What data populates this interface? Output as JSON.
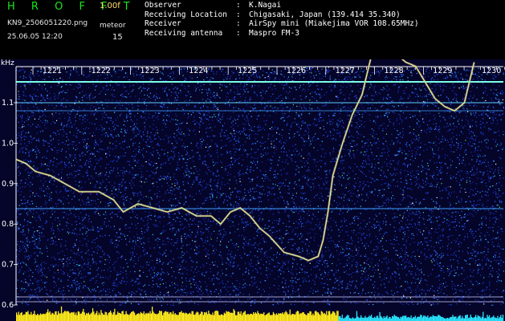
{
  "header": {
    "logo": "H R O F F T",
    "version": "1.00f",
    "filename": "KN9_2506051220.png",
    "timestamp": "25.06.05 12:20",
    "meteor_label": "meteor",
    "meteor_count": "15"
  },
  "info": [
    {
      "key": "Observer",
      "sep": ":",
      "value": "K.Nagai"
    },
    {
      "key": "Receiving Location",
      "sep": ":",
      "value": "Chigasaki, Japan (139.414 35.340)"
    },
    {
      "key": "Receiver",
      "sep": ":",
      "value": "AirSpy mini (Miakejima VOR 108.65MHz)"
    },
    {
      "key": "Receiving antenna",
      "sep": ":",
      "value": "Maspro FM-3"
    }
  ],
  "axis": {
    "y_unit": "kHz",
    "y_ticks": [
      {
        "value": 1.1,
        "label": "1.1"
      },
      {
        "value": 1.0,
        "label": "1.0"
      },
      {
        "value": 0.9,
        "label": "0.9"
      },
      {
        "value": 0.8,
        "label": "0.8"
      },
      {
        "value": 0.7,
        "label": "0.7"
      },
      {
        "value": 0.6,
        "label": "0.6"
      }
    ],
    "time_ticks": [
      "1221",
      "1222",
      "1223",
      "1224",
      "1225",
      "1226",
      "1227",
      "1228",
      "1229",
      "1230"
    ]
  },
  "colors": {
    "background": "#05052a",
    "noise": [
      "#1a34c8",
      "#2e66ff",
      "#3fa0ff",
      "#28d8ff",
      "#ffffff",
      "#6be06b"
    ],
    "trace": "#b8ff9a",
    "bars_left": "#ffeb1c",
    "bars_right": "#29e6ff",
    "text": "#ffffff"
  },
  "trace_points": [
    [
      0.0,
      0.96
    ],
    [
      0.02,
      0.95
    ],
    [
      0.04,
      0.93
    ],
    [
      0.07,
      0.92
    ],
    [
      0.1,
      0.9
    ],
    [
      0.13,
      0.88
    ],
    [
      0.17,
      0.88
    ],
    [
      0.2,
      0.86
    ],
    [
      0.22,
      0.83
    ],
    [
      0.25,
      0.85
    ],
    [
      0.28,
      0.84
    ],
    [
      0.31,
      0.83
    ],
    [
      0.34,
      0.84
    ],
    [
      0.37,
      0.82
    ],
    [
      0.4,
      0.82
    ],
    [
      0.42,
      0.8
    ],
    [
      0.44,
      0.83
    ],
    [
      0.46,
      0.84
    ],
    [
      0.48,
      0.82
    ],
    [
      0.5,
      0.79
    ],
    [
      0.52,
      0.77
    ],
    [
      0.55,
      0.73
    ],
    [
      0.58,
      0.72
    ],
    [
      0.6,
      0.71
    ],
    [
      0.62,
      0.72
    ],
    [
      0.63,
      0.76
    ],
    [
      0.64,
      0.83
    ],
    [
      0.65,
      0.92
    ],
    [
      0.67,
      1.0
    ],
    [
      0.69,
      1.07
    ],
    [
      0.71,
      1.12
    ],
    [
      0.72,
      1.17
    ],
    [
      0.73,
      1.22
    ]
  ],
  "trace_points_right": [
    [
      0.78,
      1.22
    ],
    [
      0.8,
      1.2
    ],
    [
      0.82,
      1.19
    ],
    [
      0.84,
      1.15
    ],
    [
      0.86,
      1.11
    ],
    [
      0.88,
      1.09
    ],
    [
      0.9,
      1.08
    ],
    [
      0.92,
      1.1
    ],
    [
      0.93,
      1.15
    ],
    [
      0.94,
      1.2
    ]
  ]
}
